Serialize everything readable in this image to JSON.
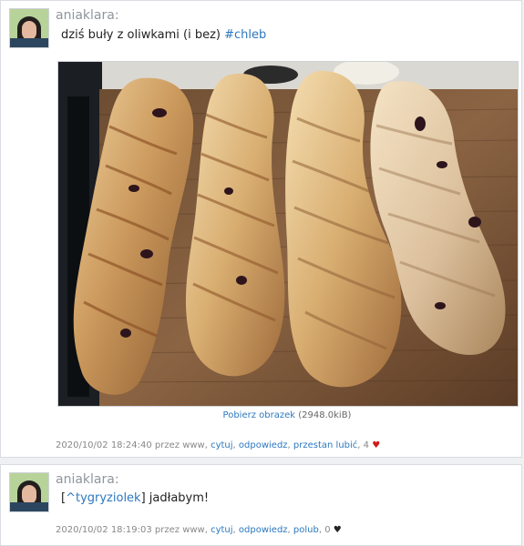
{
  "posts": [
    {
      "author": "aniaklara:",
      "message_text": "dziś buły z oliwkami (i bez) ",
      "hashtag": "#chleb",
      "download": {
        "label": "Pobierz obrazek",
        "size": "(2948.0kiB)"
      },
      "footer": {
        "meta": "2020/10/02 18:24:40 przez www, ",
        "actions": [
          "cytuj",
          "odpowiedz",
          "przestan lubić"
        ],
        "count": "4",
        "heart_color": "#d01b1b"
      }
    },
    {
      "author": "aniaklara:",
      "mention": "^tygryziolek",
      "message_prefix": "[",
      "message_suffix": "] jadłabym!",
      "footer": {
        "meta": "2020/10/02 18:19:03 przez www, ",
        "actions": [
          "cytuj",
          "odpowiedz",
          "polub"
        ],
        "count": "0",
        "heart_color": "#222222"
      }
    }
  ],
  "icons": {
    "avatar": "avatar",
    "heart": "heart-icon"
  },
  "colors": {
    "link": "#2c78bf",
    "muted": "#888888",
    "text": "#222222"
  }
}
